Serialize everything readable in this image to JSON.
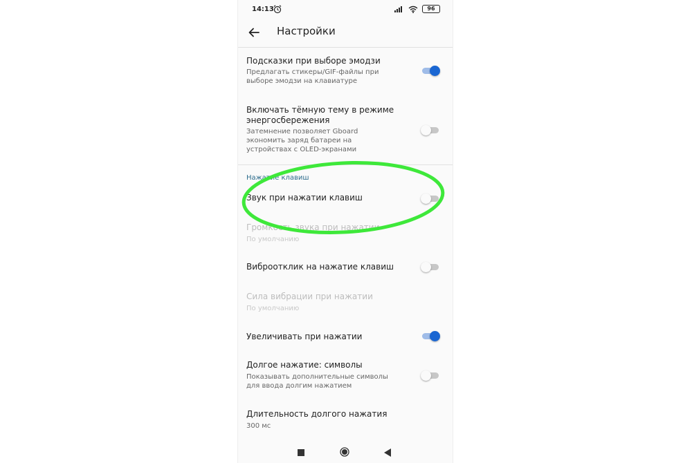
{
  "status_bar": {
    "time": "14:13",
    "battery": "96"
  },
  "toolbar": {
    "title": "Настройки"
  },
  "settings": {
    "emoji_hints": {
      "title": "Подсказки при выборе эмодзи",
      "subtitle": "Предлагать стикеры/GIF-файлы при выборе эмодзи на клавиатуре",
      "enabled": true
    },
    "dark_theme": {
      "title": "Включать тёмную тему в режиме энергосбережения",
      "subtitle": "Затемнение позволяет Gboard экономить заряд батареи на устройствах с OLED-экранами",
      "enabled": false
    },
    "section_keypress": "Нажатие клавиш",
    "key_sound": {
      "title": "Звук при нажатии клавиш",
      "enabled": false
    },
    "sound_volume": {
      "title": "Громкость звука при нажатии",
      "subtitle": "По умолчанию",
      "disabled": true
    },
    "vibration": {
      "title": "Виброотклик на нажатие клавиш",
      "enabled": false
    },
    "vibration_strength": {
      "title": "Сила вибрации при нажатии",
      "subtitle": "По умолчанию",
      "disabled": true
    },
    "magnify": {
      "title": "Увеличивать при нажатии",
      "enabled": true
    },
    "long_press_symbols": {
      "title": "Долгое нажатие: символы",
      "subtitle": "Показывать дополнительные символы для ввода долгим нажатием",
      "enabled": false
    },
    "long_press_duration": {
      "title": "Длительность долгого нажатия",
      "subtitle": "300 мс"
    }
  },
  "colors": {
    "accent": "#1a66d2",
    "highlight": "#3ee83a",
    "section_header": "#2d6c8c"
  },
  "icons": {
    "back": "arrow-left-icon",
    "alarm": "alarm-clock-icon",
    "signal": "signal-icon",
    "wifi": "wifi-icon",
    "battery": "battery-icon"
  }
}
